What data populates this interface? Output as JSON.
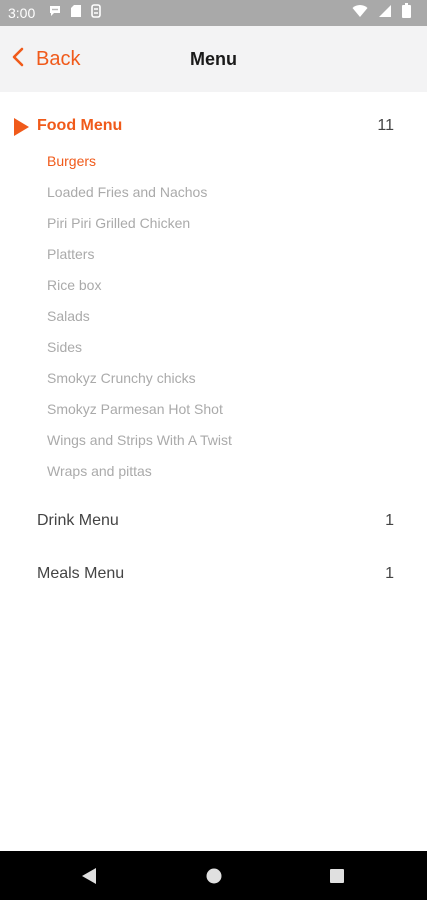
{
  "status_bar": {
    "time": "3:00",
    "left_icons": [
      "chat-icon",
      "sd-card-icon",
      "sync-icon"
    ],
    "right_icons": [
      "wifi-icon",
      "signal-icon",
      "battery-icon"
    ]
  },
  "header": {
    "back_label": "Back",
    "title": "Menu"
  },
  "colors": {
    "accent": "#f05a1a",
    "status_bar": "#a9a9a9",
    "header_bg": "#f3f3f4",
    "subitem_text": "#aaaaaa"
  },
  "categories": [
    {
      "label": "Food Menu",
      "count": "11",
      "expanded": true,
      "items": [
        "Burgers",
        "Loaded Fries and Nachos",
        "Piri Piri Grilled Chicken",
        "Platters",
        "Rice box",
        "Salads",
        "Sides",
        "Smokyz Crunchy chicks",
        "Smokyz Parmesan Hot Shot",
        "Wings and Strips With A Twist",
        "Wraps and pittas"
      ],
      "selected_item": "Burgers"
    },
    {
      "label": "Drink Menu",
      "count": "1",
      "expanded": false
    },
    {
      "label": "Meals Menu",
      "count": "1",
      "expanded": false
    }
  ],
  "system_nav": [
    "back-triangle-icon",
    "home-circle-icon",
    "recents-square-icon"
  ]
}
